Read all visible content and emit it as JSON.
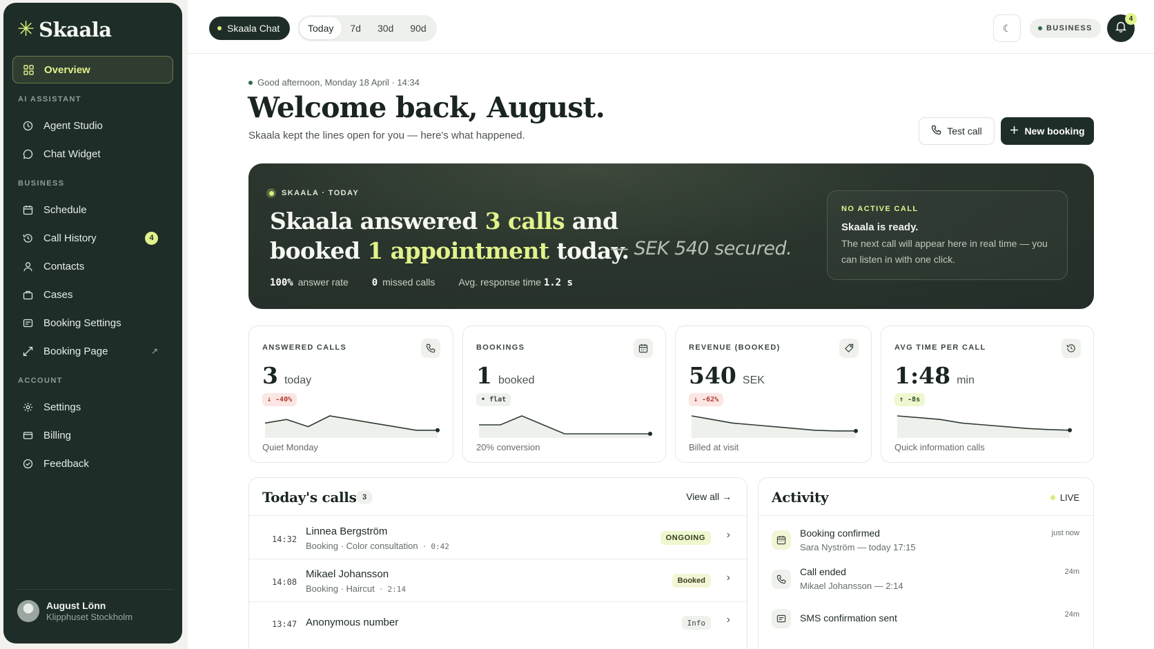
{
  "brand": {
    "name": "Skaala",
    "mark": "✳"
  },
  "sidebar": {
    "overview": "Overview",
    "sections": {
      "ai": "AI ASSISTANT",
      "business": "BUSINESS",
      "account": "ACCOUNT"
    },
    "items": {
      "agent_studio": "Agent Studio",
      "chat_widget": "Chat Widget",
      "schedule": "Schedule",
      "call_history": "Call History",
      "call_history_badge": "4",
      "contacts": "Contacts",
      "cases": "Cases",
      "booking_settings": "Booking Settings",
      "booking_page": "Booking Page",
      "booking_page_ext": "↗",
      "settings": "Settings",
      "billing": "Billing",
      "feedback": "Feedback"
    },
    "user": {
      "name": "August Lönn",
      "org": "Klipphuset Stockholm"
    }
  },
  "topbar": {
    "chat_pill": "Skaala Chat",
    "ranges": [
      "Today",
      "7d",
      "30d",
      "90d"
    ],
    "active_range": "Today",
    "theme_icon": "☾",
    "business_pill": "BUSINESS",
    "bell_badge": "4"
  },
  "header": {
    "greeting": "Good afternoon, Monday 18 April · 14:34",
    "welcome": "Welcome back, August.",
    "subtitle": "Skaala kept the lines open for you — here's what happened.",
    "test_call": "Test call",
    "new_booking": "New booking"
  },
  "hero": {
    "tag": "SKAALA · TODAY",
    "line1_pre": "Skaala answered ",
    "line1_hl": "3 calls",
    "line1_post": " and",
    "line2_pre": "booked ",
    "line2_hl": "1 appointment",
    "line2_post": " today.",
    "secured": "— SEK 540 secured.",
    "stats": [
      {
        "value": "100%",
        "label": "answer rate"
      },
      {
        "value": "0",
        "label": "missed calls"
      },
      {
        "label": "Avg. response time",
        "value": "1.2 s"
      }
    ],
    "card": {
      "title": "NO ACTIVE CALL",
      "head": "Skaala is ready.",
      "body": "The next call will appear here in real time — you can listen in with one click."
    }
  },
  "kpis": [
    {
      "label": "ANSWERED CALLS",
      "value": "3",
      "unit": "today",
      "delta": "↓ -40%",
      "delta_kind": "down",
      "foot": "Quiet Monday",
      "icon": "phone-icon",
      "trend": [
        3,
        4,
        2,
        5,
        4,
        3,
        2,
        1,
        1
      ]
    },
    {
      "label": "BOOKINGS",
      "value": "1",
      "unit": "booked",
      "delta": "• flat",
      "delta_kind": "flat",
      "foot": "20% conversion",
      "icon": "calendar-icon",
      "trend": [
        1,
        1,
        2,
        1,
        0,
        0,
        0,
        0,
        0
      ]
    },
    {
      "label": "REVENUE (BOOKED)",
      "value": "540",
      "unit": "SEK",
      "delta": "↓ -62%",
      "delta_kind": "down",
      "foot": "Billed at visit",
      "icon": "tag-icon",
      "trend": [
        5,
        4,
        3,
        2.5,
        2,
        1.5,
        1,
        0.8,
        0.8
      ]
    },
    {
      "label": "AVG TIME PER CALL",
      "value": "1:48",
      "unit": "min",
      "delta": "↑ -8s",
      "delta_kind": "up",
      "foot": "Quick information calls",
      "icon": "history-icon",
      "trend": [
        5,
        4.5,
        4,
        3,
        2.5,
        2,
        1.5,
        1.2,
        1
      ]
    }
  ],
  "calls": {
    "title": "Today's calls",
    "count": "3",
    "view_all": "View all →",
    "rows": [
      {
        "time": "14:32",
        "name": "Linnea Bergström",
        "type": "Booking",
        "service": "Color consultation",
        "duration": "0:42",
        "status": "ONGOING",
        "status_kind": "ongoing"
      },
      {
        "time": "14:08",
        "name": "Mikael Johansson",
        "type": "Booking",
        "service": "Haircut",
        "duration": "2:14",
        "status": "Booked",
        "status_kind": "booked"
      },
      {
        "time": "13:47",
        "name": "Anonymous number",
        "type": "",
        "service": "",
        "duration": "",
        "status": "Info",
        "status_kind": "info"
      }
    ]
  },
  "activity": {
    "title": "Activity",
    "live": "LIVE",
    "rows": [
      {
        "title": "Booking confirmed",
        "sub": "Sara Nyström — today 17:15",
        "time": "just now",
        "icon": "calendar-icon"
      },
      {
        "title": "Call ended",
        "sub": "Mikael Johansson — 2:14",
        "time": "24m",
        "icon": "phone-icon"
      },
      {
        "title": "SMS confirmation sent",
        "sub": "",
        "time": "24m",
        "icon": "message-icon"
      }
    ]
  }
}
